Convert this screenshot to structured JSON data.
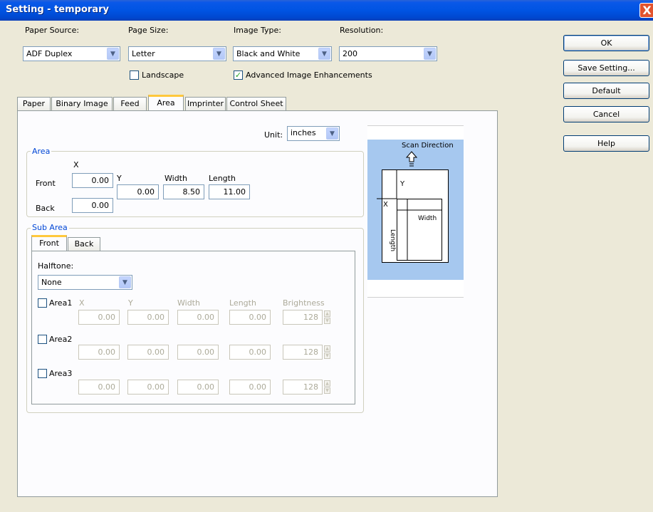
{
  "window": {
    "title": "Setting - temporary",
    "close_label": "X"
  },
  "top": {
    "paper_source": {
      "label": "Paper Source:",
      "value": "ADF Duplex"
    },
    "page_size": {
      "label": "Page Size:",
      "value": "Letter"
    },
    "image_type": {
      "label": "Image Type:",
      "value": "Black and White"
    },
    "resolution": {
      "label": "Resolution:",
      "value": "200"
    },
    "landscape": {
      "label": "Landscape",
      "checked": false
    },
    "advanced": {
      "label": "Advanced Image Enhancements",
      "checked": true
    }
  },
  "buttons": {
    "ok": "OK",
    "save": "Save Setting...",
    "default": "Default",
    "cancel": "Cancel",
    "help": "Help"
  },
  "tabs": [
    "Paper",
    "Binary Image",
    "Feed",
    "Area",
    "Imprinter",
    "Control Sheet"
  ],
  "selected_tab": "Area",
  "unit": {
    "label": "Unit:",
    "value": "inches"
  },
  "area": {
    "title": "Area",
    "x_label": "X",
    "y_label": "Y",
    "width_label": "Width",
    "length_label": "Length",
    "front_label": "Front",
    "back_label": "Back",
    "front_x": "0.00",
    "back_x": "0.00",
    "y": "0.00",
    "width": "8.50",
    "length": "11.00"
  },
  "subarea": {
    "title": "Sub Area",
    "tabs": [
      "Front",
      "Back"
    ],
    "halftone_label": "Halftone:",
    "halftone_value": "None",
    "col_x": "X",
    "col_y": "Y",
    "col_width": "Width",
    "col_length": "Length",
    "col_brightness": "Brightness",
    "rows": [
      {
        "label": "Area1",
        "x": "0.00",
        "y": "0.00",
        "width": "0.00",
        "length": "0.00",
        "brightness": "128"
      },
      {
        "label": "Area2",
        "x": "0.00",
        "y": "0.00",
        "width": "0.00",
        "length": "0.00",
        "brightness": "128"
      },
      {
        "label": "Area3",
        "x": "0.00",
        "y": "0.00",
        "width": "0.00",
        "length": "0.00",
        "brightness": "128"
      }
    ]
  },
  "preview": {
    "scan_direction": "Scan Direction",
    "y": "Y",
    "x": "X",
    "width": "Width",
    "length": "Length"
  }
}
